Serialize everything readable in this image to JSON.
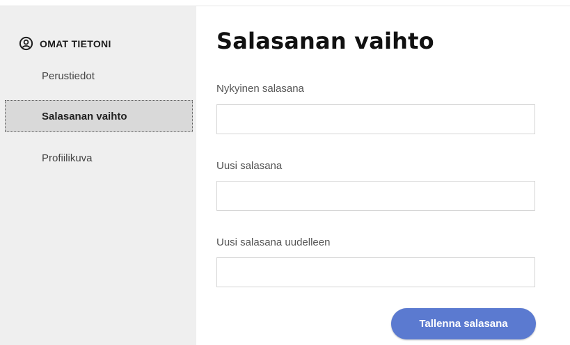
{
  "sidebar": {
    "header_label": "OMAT TIETONI",
    "header_icon": "user-circle-icon",
    "items": [
      {
        "label": "Perustiedot",
        "active": false
      },
      {
        "label": "Salasanan vaihto",
        "active": true
      },
      {
        "label": "Profiilikuva",
        "active": false
      }
    ]
  },
  "main": {
    "title": "Salasanan vaihto",
    "fields": [
      {
        "label": "Nykyinen salasana",
        "value": "",
        "placeholder": ""
      },
      {
        "label": "Uusi salasana",
        "value": "",
        "placeholder": ""
      },
      {
        "label": "Uusi salasana uudelleen",
        "value": "",
        "placeholder": ""
      }
    ],
    "save_label": "Tallenna salasana"
  },
  "colors": {
    "accent": "#5b7ad0",
    "sidebar_bg": "#efefef",
    "active_item_bg": "#d9d9d9"
  }
}
